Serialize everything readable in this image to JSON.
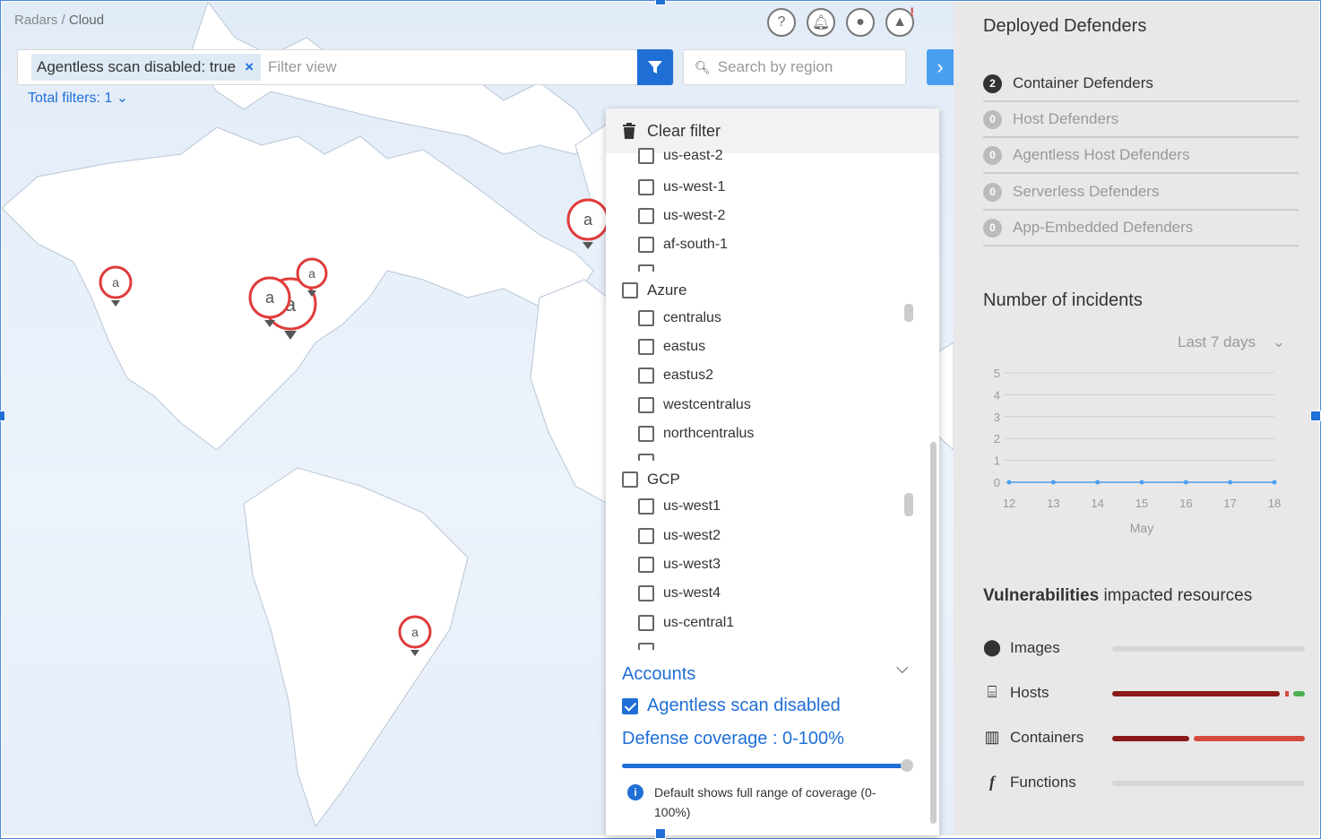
{
  "breadcrumb": {
    "parent": "Radars",
    "separator": " / ",
    "current": "Cloud"
  },
  "topbar": {
    "icons": [
      "help-icon",
      "bell-icon",
      "user-icon",
      "alert-radar-icon"
    ]
  },
  "filter": {
    "chip_label": "Agentless scan disabled: true",
    "chip_remove": "×",
    "placeholder": "Filter view",
    "total_filters": "Total filters: 1"
  },
  "search": {
    "placeholder": "Search by region"
  },
  "dropdown": {
    "clear_label": "Clear filter",
    "aws_partial": "us-east-2",
    "aws_regions": [
      "us-west-1",
      "us-west-2",
      "af-south-1"
    ],
    "azure": {
      "label": "Azure",
      "regions": [
        "centralus",
        "eastus",
        "eastus2",
        "westcentralus",
        "northcentralus"
      ]
    },
    "gcp": {
      "label": "GCP",
      "regions": [
        "us-west1",
        "us-west2",
        "us-west3",
        "us-west4",
        "us-central1"
      ]
    },
    "accounts_label": "Accounts",
    "agentless_label": "Agentless scan disabled",
    "agentless_checked": true,
    "coverage_label": "Defense coverage : 0-100%",
    "coverage_min": 0,
    "coverage_max": 100,
    "info_text": "Default shows full range of coverage (0-100%)"
  },
  "side": {
    "deployed_title": "Deployed Defenders",
    "defenders": [
      {
        "count": "2",
        "label": "Container Defenders",
        "active": true
      },
      {
        "count": "0",
        "label": "Host Defenders",
        "active": false
      },
      {
        "count": "0",
        "label": "Agentless Host Defenders",
        "active": false
      },
      {
        "count": "0",
        "label": "Serverless Defenders",
        "active": false
      },
      {
        "count": "0",
        "label": "App-Embedded Defenders",
        "active": false
      }
    ],
    "incidents_title": "Number of incidents",
    "range_label": "Last 7 days",
    "vuln_title_bold": "Vulnerabilities",
    "vuln_title_rest": " impacted resources",
    "vulns": [
      {
        "label": "Images",
        "icon": "circle-dot-icon"
      },
      {
        "label": "Hosts",
        "icon": "server-icon"
      },
      {
        "label": "Containers",
        "icon": "container-icon"
      },
      {
        "label": "Functions",
        "icon": "function-icon"
      }
    ]
  },
  "chart_data": {
    "type": "line",
    "x": [
      "12",
      "13",
      "14",
      "15",
      "16",
      "17",
      "18"
    ],
    "series": [
      {
        "values": [
          0,
          0,
          0,
          0,
          0,
          0,
          0
        ]
      }
    ],
    "xlabel": "May",
    "ylabel": "",
    "ylim": [
      0,
      5
    ],
    "yticks": [
      "0",
      "1",
      "2",
      "3",
      "4",
      "5"
    ],
    "color": "#4a9ef0"
  },
  "colors": {
    "accent": "#1f6fd6",
    "critical": "#8b1a1a",
    "high": "#d44a3f",
    "low": "#4caf50"
  }
}
